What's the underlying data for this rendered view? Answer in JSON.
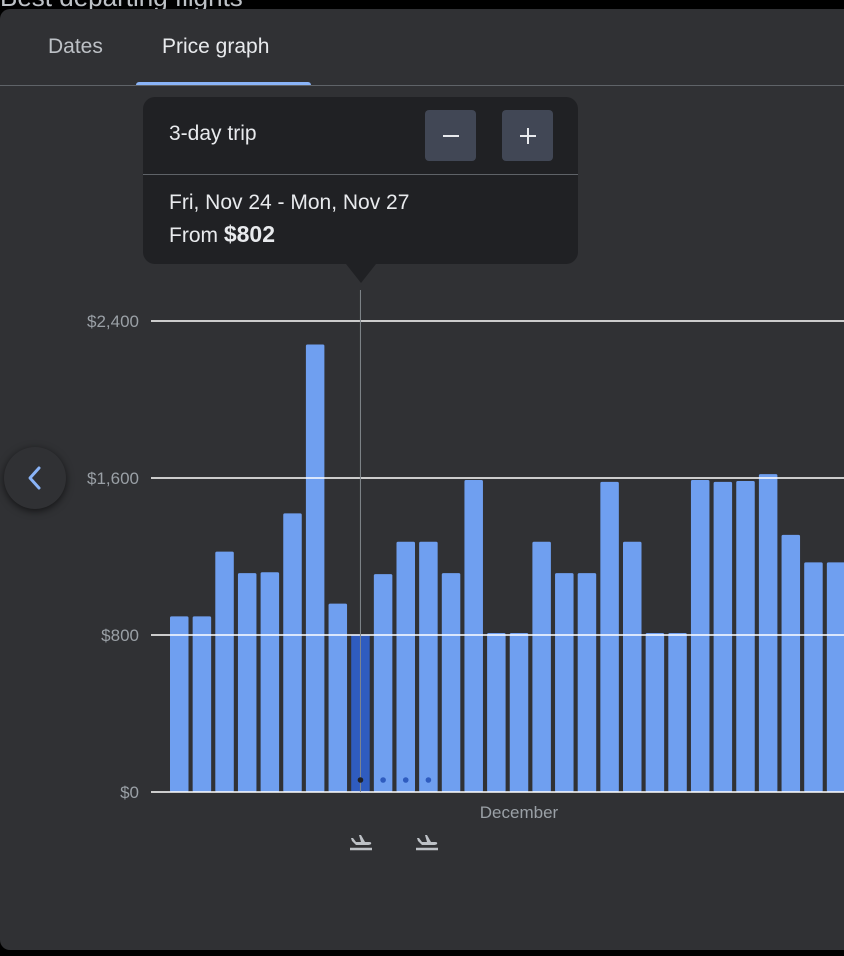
{
  "background_heading": "Best departing flights",
  "tabs": [
    {
      "label": "Dates",
      "selected": false
    },
    {
      "label": "Price graph",
      "selected": true
    }
  ],
  "popup": {
    "trip_length": "3-day trip",
    "minus_icon": "minus-icon",
    "plus_icon": "plus-icon",
    "dates": "Fri, Nov 24 - Mon, Nov 27",
    "price_prefix": "From",
    "price": "$802"
  },
  "nav": {
    "icon": "chevron-left-icon"
  },
  "chart_data": {
    "type": "bar",
    "title": "",
    "xlabel": "December",
    "ylabel": "",
    "ylim": [
      0,
      2400
    ],
    "y_ticks": [
      "$0",
      "$800",
      "$1,600",
      "$2,400"
    ],
    "y_tick_values": [
      0,
      800,
      1600,
      2400
    ],
    "grid": true,
    "values": [
      895,
      895,
      1225,
      1115,
      1120,
      1420,
      2280,
      960,
      802,
      1110,
      1275,
      1275,
      1115,
      1590,
      810,
      810,
      1275,
      1115,
      1115,
      1580,
      1275,
      810,
      810,
      1590,
      1580,
      1585,
      1620,
      1310,
      1170,
      1170
    ],
    "selected_index": 8,
    "colors": {
      "bar": "#6f9ff0",
      "selected_bar": "#2f5cbf",
      "grid": "#ffffff",
      "dot": "#2f5cbf",
      "dot_active": "#202124"
    }
  },
  "legend_icons": [
    "departure-icon",
    "return-icon"
  ]
}
